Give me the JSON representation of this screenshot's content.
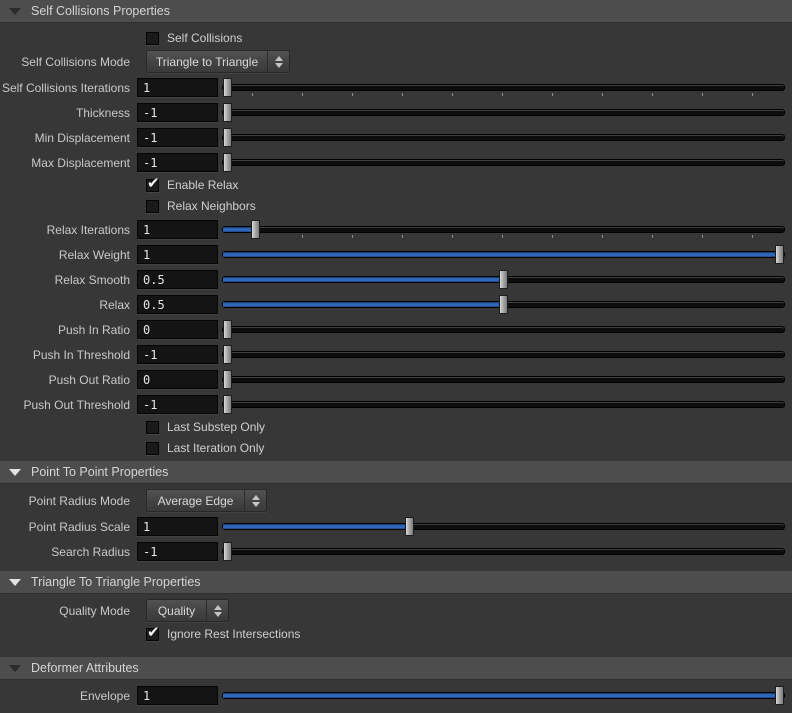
{
  "colors": {
    "accent_blue": "#2f67ba",
    "panel_background": "#373737",
    "header_background": "#4d4d4d",
    "field_background": "#141414"
  },
  "sections": {
    "self_collisions": {
      "title": "Self Collisions Properties",
      "self_collisions_checkbox": {
        "label": "Self Collisions",
        "checked": false
      },
      "mode": {
        "label": "Self Collisions Mode",
        "value": "Triangle to Triangle"
      },
      "iterations": {
        "label": "Self Collisions Iterations",
        "value": "1",
        "percent": 0
      },
      "thickness": {
        "label": "Thickness",
        "value": "-1",
        "percent": 0
      },
      "min_displacement": {
        "label": "Min Displacement",
        "value": "-1",
        "percent": 0
      },
      "max_displacement": {
        "label": "Max Displacement",
        "value": "-1",
        "percent": 0
      },
      "enable_relax": {
        "label": "Enable Relax",
        "checked": true
      },
      "relax_neighbors": {
        "label": "Relax Neighbors",
        "checked": false
      },
      "relax_iterations": {
        "label": "Relax Iterations",
        "value": "1",
        "percent": 5
      },
      "relax_weight": {
        "label": "Relax Weight",
        "value": "1",
        "percent": 100
      },
      "relax_smooth": {
        "label": "Relax Smooth",
        "value": "0.5",
        "percent": 50
      },
      "relax": {
        "label": "Relax",
        "value": "0.5",
        "percent": 50
      },
      "push_in_ratio": {
        "label": "Push In Ratio",
        "value": "0",
        "percent": 0
      },
      "push_in_threshold": {
        "label": "Push In Threshold",
        "value": "-1",
        "percent": 0
      },
      "push_out_ratio": {
        "label": "Push Out Ratio",
        "value": "0",
        "percent": 0
      },
      "push_out_threshold": {
        "label": "Push Out Threshold",
        "value": "-1",
        "percent": 0
      },
      "last_substep_only": {
        "label": "Last Substep Only",
        "checked": false
      },
      "last_iteration_only": {
        "label": "Last Iteration Only",
        "checked": false
      }
    },
    "point_to_point": {
      "title": "Point To Point Properties",
      "point_radius_mode": {
        "label": "Point Radius Mode",
        "value": "Average Edge"
      },
      "point_radius_scale": {
        "label": "Point Radius Scale",
        "value": "1",
        "percent": 33
      },
      "search_radius": {
        "label": "Search Radius",
        "value": "-1",
        "percent": 0
      }
    },
    "triangle_to_triangle": {
      "title": "Triangle To Triangle Properties",
      "quality_mode": {
        "label": "Quality Mode",
        "value": "Quality"
      },
      "ignore_rest_intersections": {
        "label": "Ignore Rest Intersections",
        "checked": true
      }
    },
    "deformer": {
      "title": "Deformer Attributes",
      "envelope": {
        "label": "Envelope",
        "value": "1",
        "percent": 100
      }
    }
  }
}
